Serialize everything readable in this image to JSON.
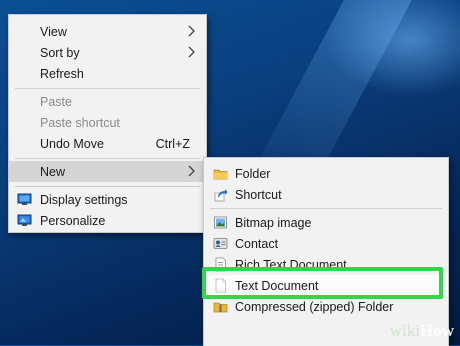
{
  "context_menu": {
    "items": [
      {
        "label": "View",
        "submenu": true
      },
      {
        "label": "Sort by",
        "submenu": true
      },
      {
        "label": "Refresh"
      },
      {
        "label": "Paste",
        "disabled": true
      },
      {
        "label": "Paste shortcut",
        "disabled": true
      },
      {
        "label": "Undo Move",
        "shortcut": "Ctrl+Z"
      },
      {
        "label": "New",
        "submenu": true,
        "highlighted": true
      },
      {
        "label": "Display settings",
        "icon": "display-settings-icon"
      },
      {
        "label": "Personalize",
        "icon": "personalize-icon"
      }
    ]
  },
  "new_submenu": {
    "items": [
      {
        "label": "Folder",
        "icon": "folder-icon"
      },
      {
        "label": "Shortcut",
        "icon": "shortcut-icon"
      },
      {
        "label": "Bitmap image",
        "icon": "bitmap-image-icon"
      },
      {
        "label": "Contact",
        "icon": "contact-icon"
      },
      {
        "label": "Rich Text Document",
        "icon": "rich-text-document-icon"
      },
      {
        "label": "Text Document",
        "icon": "text-document-icon",
        "highlighted": true
      },
      {
        "label": "Compressed (zipped) Folder",
        "icon": "zip-folder-icon"
      }
    ]
  },
  "colors": {
    "highlight_border": "#36d44a",
    "desktop_background": "#0a3f7d"
  },
  "watermark": {
    "prefix": "wiki",
    "suffix": "How"
  }
}
